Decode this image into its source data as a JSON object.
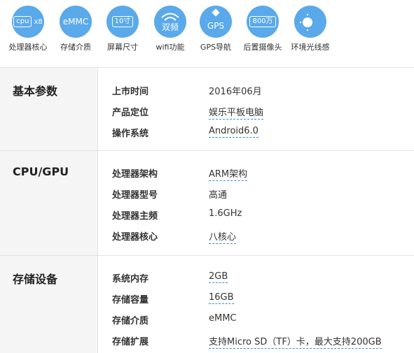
{
  "features": [
    {
      "label": "处理器核心",
      "glyph_a": "cpu",
      "glyph_b": "x8",
      "icon": "cpu-chip-icon"
    },
    {
      "label": "存储介质",
      "glyph_a": "eMMC",
      "icon": "storage-icon"
    },
    {
      "label": "屏幕尺寸",
      "glyph_a": "10寸",
      "icon": "screen-size-icon"
    },
    {
      "label": "wifi功能",
      "glyph_a": "双频",
      "icon": "wifi-icon"
    },
    {
      "label": "GPS导航",
      "glyph_a": "GPS",
      "icon": "satellite-icon"
    },
    {
      "label": "后置摄像头",
      "glyph_a": "800万",
      "icon": "camera-icon"
    },
    {
      "label": "环境光线感",
      "glyph_a": "",
      "icon": "light-sensor-icon"
    }
  ],
  "sections": [
    {
      "title": "基本参数",
      "rows": [
        {
          "key": "上市时间",
          "value": "2016年06月",
          "linked": false
        },
        {
          "key": "产品定位",
          "value": "娱乐平板电脑",
          "linked": true
        },
        {
          "key": "操作系统",
          "value": "Android6.0",
          "linked": true
        }
      ]
    },
    {
      "title": "CPU/GPU",
      "rows": [
        {
          "key": "处理器架构",
          "value": "ARM架构",
          "linked": true
        },
        {
          "key": "处理器型号",
          "value": "高通",
          "linked": false
        },
        {
          "key": "处理器主频",
          "value": "1.6GHz",
          "linked": false
        },
        {
          "key": "处理器核心",
          "value": "八核心",
          "linked": true
        }
      ]
    },
    {
      "title": "存储设备",
      "rows": [
        {
          "key": "系统内存",
          "value": "2GB",
          "linked": true
        },
        {
          "key": "存储容量",
          "value": "16GB",
          "linked": true
        },
        {
          "key": "存储介质",
          "value": "eMMC",
          "linked": false
        },
        {
          "key": "存储扩展",
          "value": "支持Micro SD（TF）卡，最大支持200GB",
          "linked": true
        }
      ]
    }
  ],
  "colors": {
    "accent": "#5aa9ea",
    "link_underline": "#3b8bd6",
    "category_bg": "#f5f5f5"
  }
}
